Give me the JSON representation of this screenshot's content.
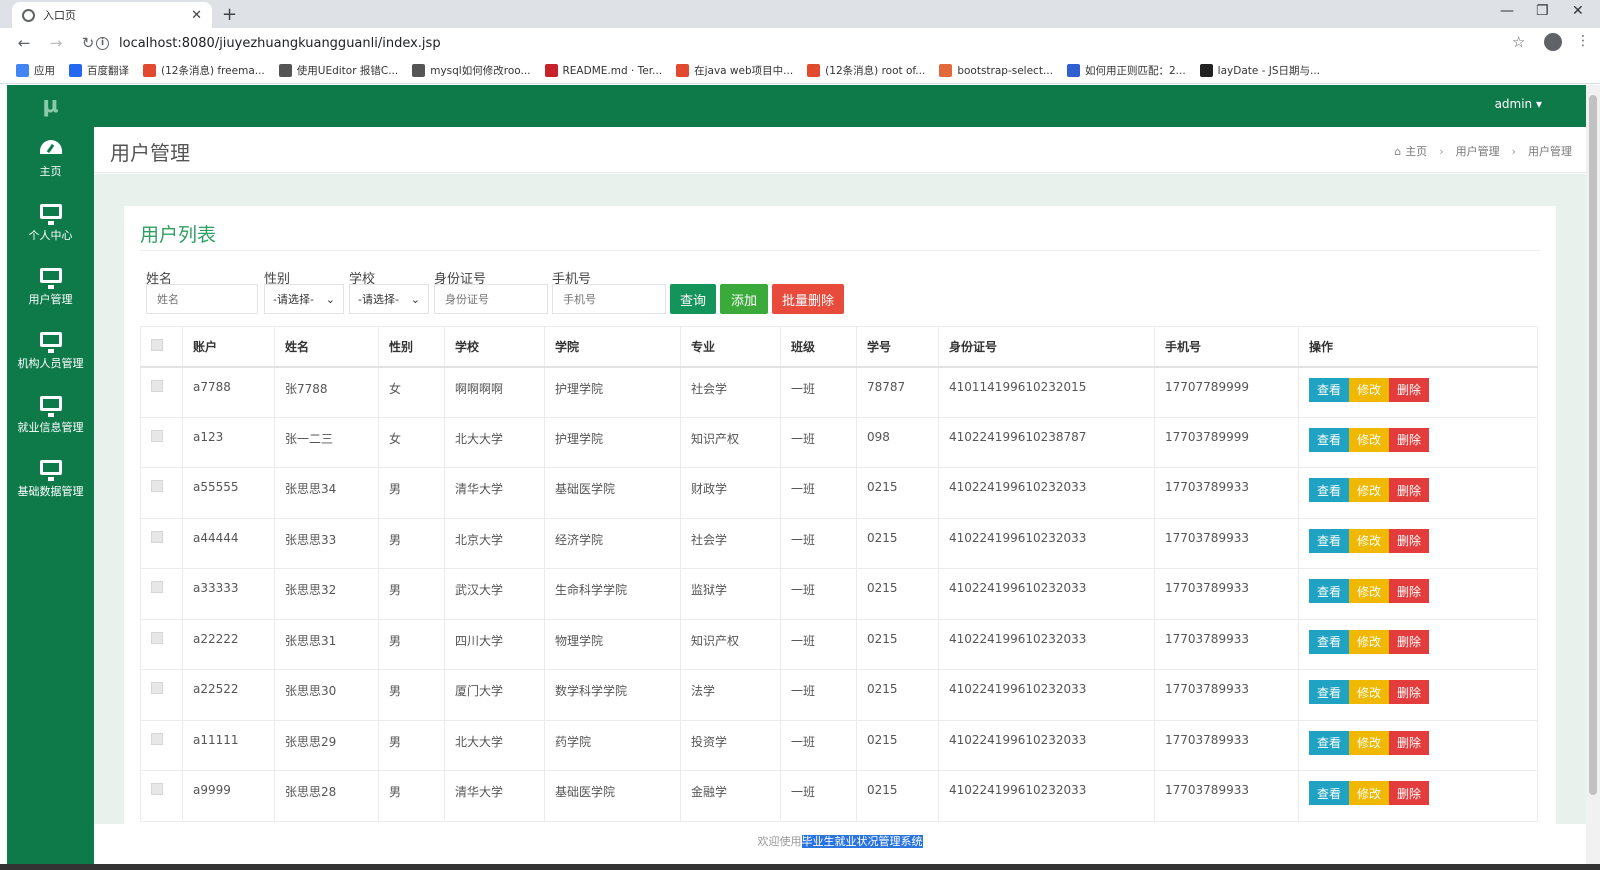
{
  "browser": {
    "tab_title": "入口页",
    "url": "localhost:8080/jiuyezhuangkuangguanli/index.jsp",
    "bookmarks": [
      {
        "label": "应用",
        "color": "#4285f4"
      },
      {
        "label": "百度翻译",
        "color": "#2468f2"
      },
      {
        "label": "(12条消息) freema...",
        "color": "#e24a2f"
      },
      {
        "label": "使用UEditor 报错C...",
        "color": "#555555"
      },
      {
        "label": "mysql如何修改roo...",
        "color": "#555555"
      },
      {
        "label": "README.md · Ter...",
        "color": "#c7222a"
      },
      {
        "label": "在java web项目中...",
        "color": "#e24a2f"
      },
      {
        "label": "(12条消息) root of...",
        "color": "#e24a2f"
      },
      {
        "label": "bootstrap-select...",
        "color": "#e26a3a"
      },
      {
        "label": "如何用正则匹配：2...",
        "color": "#3060d0"
      },
      {
        "label": "layDate - JS日期与...",
        "color": "#222222"
      }
    ]
  },
  "app": {
    "logo": "μ",
    "user": "admin ▾",
    "sidebar": [
      {
        "label": "主页",
        "icon": "dashboard-icon"
      },
      {
        "label": "个人中心",
        "icon": "monitor-icon"
      },
      {
        "label": "用户管理",
        "icon": "monitor-icon"
      },
      {
        "label": "机构人员管理",
        "icon": "monitor-icon"
      },
      {
        "label": "就业信息管理",
        "icon": "monitor-icon"
      },
      {
        "label": "基础数据管理",
        "icon": "monitor-icon"
      }
    ],
    "page_title": "用户管理",
    "breadcrumb": [
      "主页",
      "用户管理",
      "用户管理"
    ],
    "panel_title": "用户列表",
    "filters": {
      "name_label": "姓名",
      "name_placeholder": "姓名",
      "gender_label": "性别",
      "gender_value": "-请选择-",
      "school_label": "学校",
      "school_value": "-请选择-",
      "id_label": "身份证号",
      "id_placeholder": "身份证号",
      "phone_label": "手机号",
      "phone_placeholder": "手机号"
    },
    "buttons": {
      "query": "查询",
      "add": "添加",
      "batch_delete": "批量删除"
    },
    "table": {
      "headers": [
        "账户",
        "姓名",
        "性别",
        "学校",
        "学院",
        "专业",
        "班级",
        "学号",
        "身份证号",
        "手机号",
        "操作"
      ],
      "actions": {
        "view": "查看",
        "edit": "修改",
        "delete": "删除"
      },
      "rows": [
        [
          "a7788",
          "张7788",
          "女",
          "啊啊啊啊",
          "护理学院",
          "社会学",
          "一班",
          "78787",
          "410114199610232015",
          "17707789999"
        ],
        [
          "a123",
          "张一二三",
          "女",
          "北大大学",
          "护理学院",
          "知识产权",
          "一班",
          "098",
          "410224199610238787",
          "17703789999"
        ],
        [
          "a55555",
          "张思思34",
          "男",
          "清华大学",
          "基础医学院",
          "财政学",
          "一班",
          "0215",
          "410224199610232033",
          "17703789933"
        ],
        [
          "a44444",
          "张思思33",
          "男",
          "北京大学",
          "经济学院",
          "社会学",
          "一班",
          "0215",
          "410224199610232033",
          "17703789933"
        ],
        [
          "a33333",
          "张思思32",
          "男",
          "武汉大学",
          "生命科学学院",
          "监狱学",
          "一班",
          "0215",
          "410224199610232033",
          "17703789933"
        ],
        [
          "a22222",
          "张思思31",
          "男",
          "四川大学",
          "物理学院",
          "知识产权",
          "一班",
          "0215",
          "410224199610232033",
          "17703789933"
        ],
        [
          "a22522",
          "张思思30",
          "男",
          "厦门大学",
          "数学科学学院",
          "法学",
          "一班",
          "0215",
          "410224199610232033",
          "17703789933"
        ],
        [
          "a11111",
          "张思思29",
          "男",
          "北大大学",
          "药学院",
          "投资学",
          "一班",
          "0215",
          "410224199610232033",
          "17703789933"
        ],
        [
          "a9999",
          "张思思28",
          "男",
          "清华大学",
          "基础医学院",
          "金融学",
          "一班",
          "0215",
          "410224199610232033",
          "17703789933"
        ]
      ]
    },
    "footer": {
      "prefix": "欢迎使用",
      "highlight": "毕业生就业状况管理系统"
    }
  }
}
